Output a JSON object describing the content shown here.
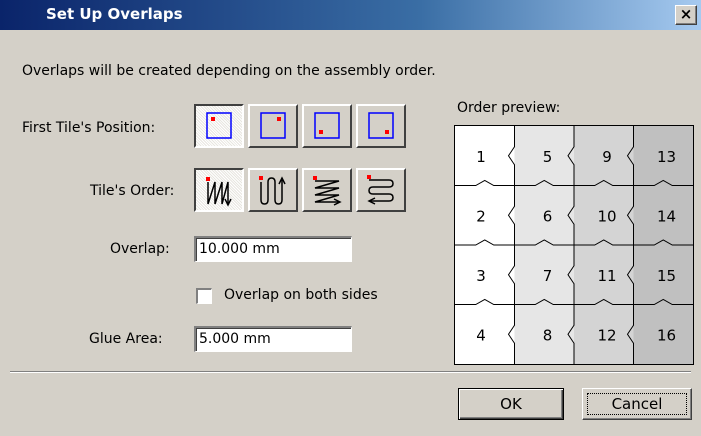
{
  "window": {
    "title": "Set Up Overlaps",
    "close_glyph": "×"
  },
  "description": "Overlaps will be created depending on the assembly order.",
  "first_tile_position": {
    "label": "First Tile's Position:",
    "options": [
      "top-left",
      "top-right",
      "bottom-left",
      "bottom-right"
    ],
    "selected": "top-left"
  },
  "tiles_order": {
    "label": "Tile's Order:",
    "options": [
      "columns-zigzag",
      "columns-snake",
      "rows-zigzag",
      "rows-snake"
    ],
    "selected": "columns-zigzag"
  },
  "overlap": {
    "label": "Overlap:",
    "value": "10.000 mm"
  },
  "overlap_both_sides": {
    "label": "Overlap on both sides",
    "checked": false
  },
  "glue_area": {
    "label": "Glue Area:",
    "value": "5.000 mm"
  },
  "order_preview": {
    "label": "Order preview:",
    "columns": [
      {
        "numbers": [
          "1",
          "2",
          "3",
          "4"
        ],
        "shade": "#ffffff"
      },
      {
        "numbers": [
          "5",
          "6",
          "7",
          "8"
        ],
        "shade": "#e6e6e6"
      },
      {
        "numbers": [
          "9",
          "10",
          "11",
          "12"
        ],
        "shade": "#d4d4d4"
      },
      {
        "numbers": [
          "13",
          "14",
          "15",
          "16"
        ],
        "shade": "#c0c0c0"
      }
    ]
  },
  "buttons": {
    "ok": "OK",
    "cancel": "Cancel"
  },
  "colors": {
    "marker": "#ff0000",
    "frame": "#0000ff",
    "title_start": "#0a246a",
    "title_end": "#a6caf0"
  }
}
